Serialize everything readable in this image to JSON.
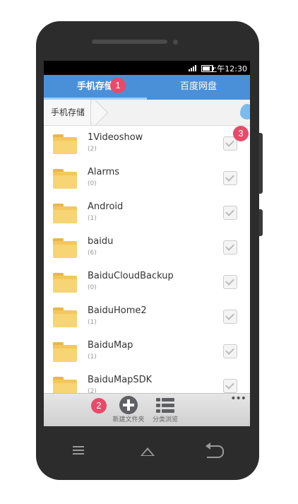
{
  "status_bar": {
    "time": "上午12:30"
  },
  "tabs": [
    {
      "label": "手机存储",
      "active": true
    },
    {
      "label": "百度网盘",
      "active": false
    }
  ],
  "breadcrumb": {
    "label": "手机存储"
  },
  "files": [
    {
      "name": "1Videoshow",
      "count": "(2)"
    },
    {
      "name": "Alarms",
      "count": "(0)"
    },
    {
      "name": "Android",
      "count": "(1)"
    },
    {
      "name": "baidu",
      "count": "(6)"
    },
    {
      "name": "BaiduCloudBackup",
      "count": "(0)"
    },
    {
      "name": "BaiduHome2",
      "count": "(1)"
    },
    {
      "name": "BaiduMap",
      "count": "(1)"
    },
    {
      "name": "BaiduMapSDK",
      "count": "(2)"
    }
  ],
  "toolbar": {
    "new_folder_label": "新建文件夹",
    "category_label": "分类浏览",
    "more_label": "•••"
  },
  "annotations": {
    "badge1": "1",
    "badge2": "2",
    "badge3": "3"
  },
  "colors": {
    "tab_bar": "#4a90d9",
    "badge": "#e84a6a",
    "folder": "#f3c75c"
  }
}
